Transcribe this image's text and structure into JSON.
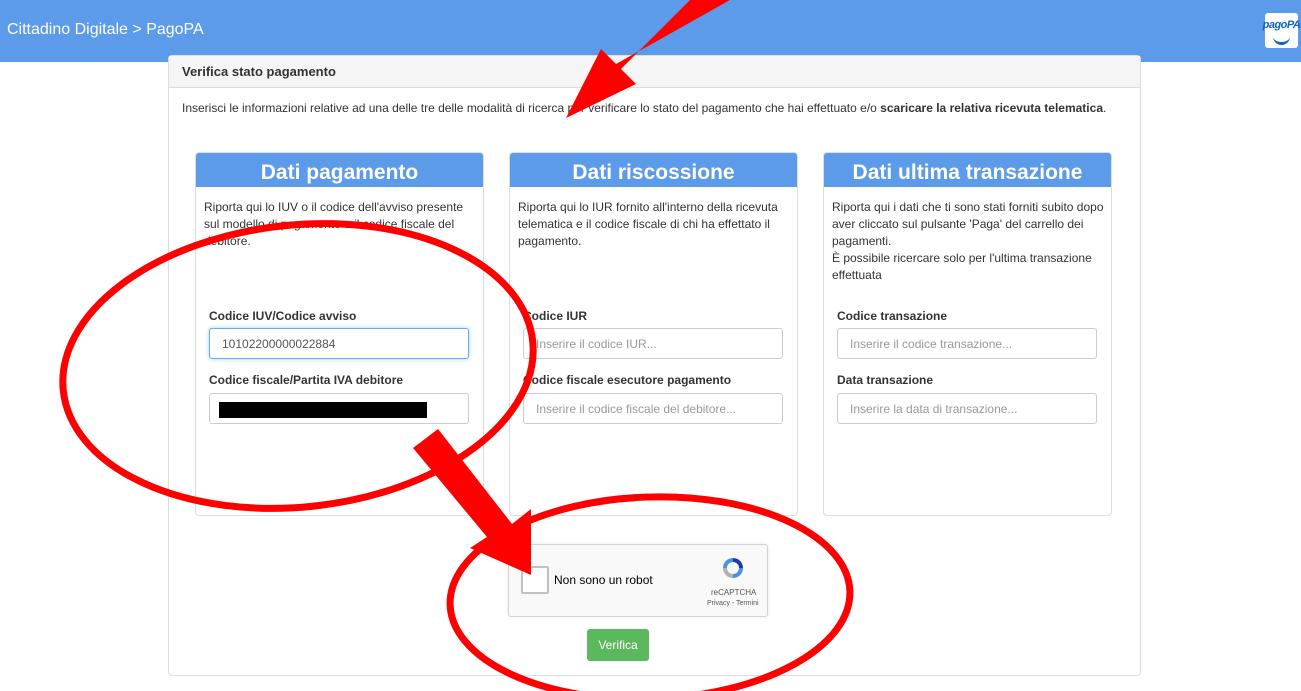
{
  "topbar": {
    "title": "Cittadino Digitale > PagoPA",
    "logo_text": "pagoPA"
  },
  "panel": {
    "title": "Verifica stato pagamento",
    "intro_prefix": "Inserisci le informazioni relative ad una delle tre delle modalità di ricerca per verificare lo stato del pagamento che hai effettuato e/o ",
    "intro_bold": "scaricare la relativa ricevuta telematica",
    "intro_suffix": "."
  },
  "cards": {
    "payment": {
      "title": "Dati pagamento",
      "description": "Riporta qui lo IUV o il codice dell'avviso presente sul modello di pagamento e il codice fiscale del debitore.",
      "field1_label": "Codice IUV/Codice avviso",
      "field1_value": "10102200000022884",
      "field2_label": "Codice fiscale/Partita IVA debitore",
      "field2_value": ""
    },
    "collection": {
      "title": "Dati riscossione",
      "description": "Riporta qui lo IUR fornito all'interno della ricevuta telematica e il codice fiscale di chi ha effettato il pagamento.",
      "field1_label": "Codice IUR",
      "field1_placeholder": "Inserire il codice IUR...",
      "field2_label": "Codice fiscale esecutore pagamento",
      "field2_placeholder": "Inserire il codice fiscale del debitore..."
    },
    "transaction": {
      "title": "Dati ultima transazione",
      "description1": "Riporta qui i dati che ti sono stati forniti subito dopo aver cliccato sul pulsante 'Paga' del carrello dei pagamenti.",
      "description2": "È possibile ricercare solo per l'ultima transazione effettuata",
      "field1_label": "Codice transazione",
      "field1_placeholder": "Inserire il codice transazione...",
      "field2_label": "Data transazione",
      "field2_placeholder": "Inserire la data di transazione..."
    }
  },
  "captcha": {
    "label": "Non sono un robot",
    "brand": "reCAPTCHA",
    "links": "Privacy - Termini"
  },
  "verify_button": "Verifica",
  "colors": {
    "header_blue": "#5b9bea",
    "button_green": "#5cb85c",
    "annotation_red": "#ff0000"
  }
}
